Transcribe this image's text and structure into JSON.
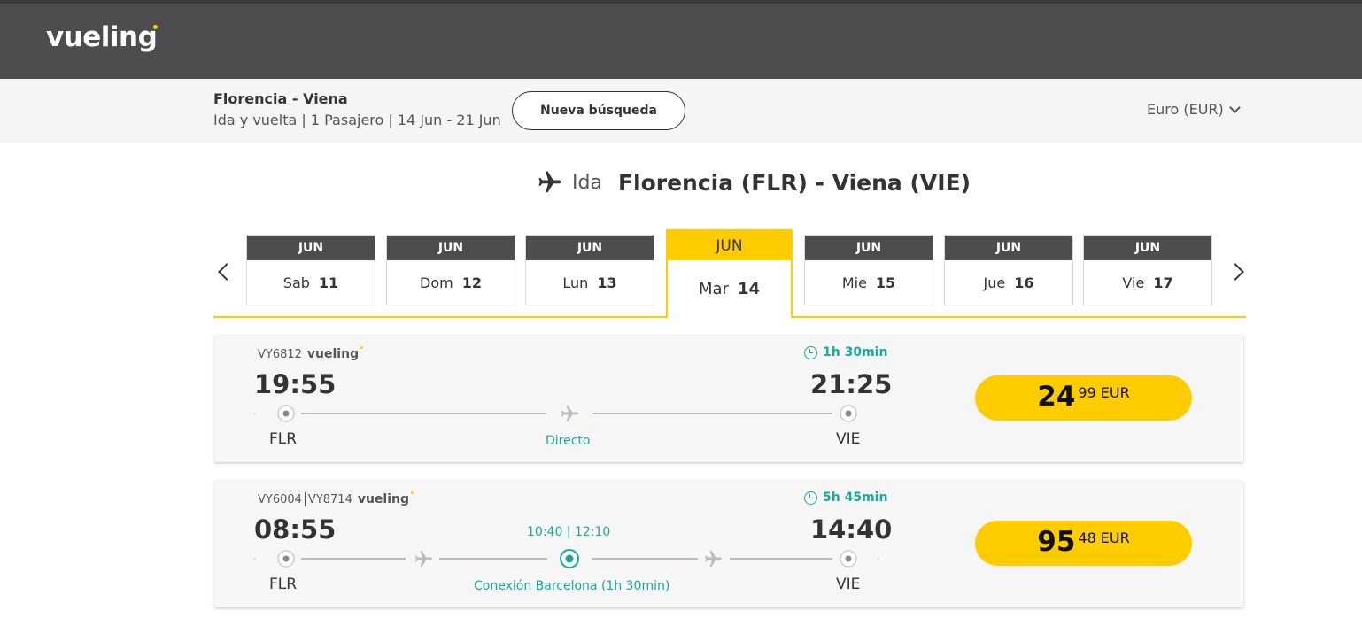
{
  "header": {
    "logo_text": "vueling",
    "brand_color": "#ffcc00"
  },
  "search": {
    "route": "Florencia - Viena",
    "details": "Ida y vuelta | 1 Pasajero | 14 Jun - 21 Jun",
    "new_search_label": "Nueva búsqueda",
    "currency": "Euro (EUR)"
  },
  "leg": {
    "label": "Ida",
    "route": "Florencia (FLR) - Viena (VIE)",
    "icon": "plane-icon"
  },
  "dates": [
    {
      "month": "JUN",
      "weekday": "Sab",
      "day": "11"
    },
    {
      "month": "JUN",
      "weekday": "Dom",
      "day": "12"
    },
    {
      "month": "JUN",
      "weekday": "Lun",
      "day": "13"
    },
    {
      "month": "JUN",
      "weekday": "Mar",
      "day": "14",
      "selected": true
    },
    {
      "month": "JUN",
      "weekday": "Mie",
      "day": "15"
    },
    {
      "month": "JUN",
      "weekday": "Jue",
      "day": "16"
    },
    {
      "month": "JUN",
      "weekday": "Vie",
      "day": "17"
    }
  ],
  "flights": [
    {
      "numbers": [
        "VY6812"
      ],
      "brand": "vueling",
      "duration": "1h 30min",
      "dep_time": "19:55",
      "arr_time": "21:25",
      "dep_airport": "FLR",
      "arr_airport": "VIE",
      "stop_label": "Directo",
      "price_int": "24",
      "price_dec": "99",
      "currency": "EUR"
    },
    {
      "numbers": [
        "VY6004",
        "VY8714"
      ],
      "brand": "vueling",
      "duration": "5h 45min",
      "dep_time": "08:55",
      "arr_time": "14:40",
      "dep_airport": "FLR",
      "arr_airport": "VIE",
      "connection_times": "10:40 | 12:10",
      "stop_label": "Conexión Barcelona (1h 30min)",
      "price_int": "95",
      "price_dec": "48",
      "currency": "EUR"
    }
  ],
  "colors": {
    "teal": "#1aaa9b",
    "yellow": "#ffcc00",
    "dark": "#4d4d4d"
  }
}
